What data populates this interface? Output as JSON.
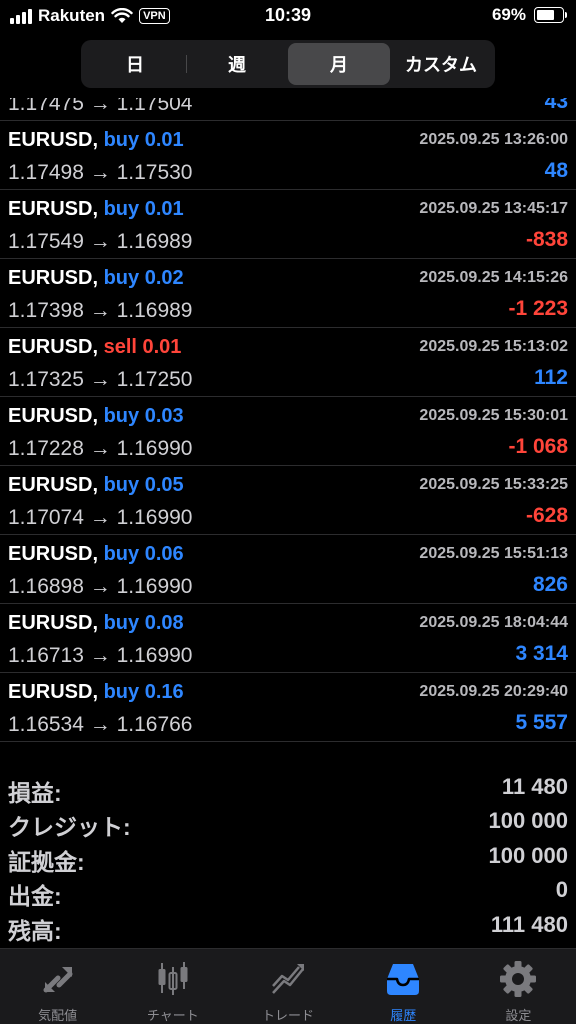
{
  "status_bar": {
    "carrier": "Rakuten",
    "vpn": "VPN",
    "time": "10:39",
    "battery": "69%",
    "battery_level": 0.69
  },
  "segments": [
    {
      "label": "日",
      "active": false
    },
    {
      "label": "週",
      "active": false
    },
    {
      "label": "月",
      "active": true
    },
    {
      "label": "カスタム",
      "active": false
    }
  ],
  "partial_row": {
    "prices": "1.17475 → 1.17504",
    "pl": "43"
  },
  "trades": [
    {
      "symbol": "EURUSD,",
      "type": "buy 0.01",
      "side": "buy",
      "datetime": "2025.09.25 13:26:00",
      "prices": "1.17498 → 1.17530",
      "pl": "48",
      "sign": "pos"
    },
    {
      "symbol": "EURUSD,",
      "type": "buy 0.01",
      "side": "buy",
      "datetime": "2025.09.25 13:45:17",
      "prices": "1.17549 → 1.16989",
      "pl": "-838",
      "sign": "neg"
    },
    {
      "symbol": "EURUSD,",
      "type": "buy 0.02",
      "side": "buy",
      "datetime": "2025.09.25 14:15:26",
      "prices": "1.17398 → 1.16989",
      "pl": "-1 223",
      "sign": "neg"
    },
    {
      "symbol": "EURUSD,",
      "type": "sell 0.01",
      "side": "sell",
      "datetime": "2025.09.25 15:13:02",
      "prices": "1.17325 → 1.17250",
      "pl": "112",
      "sign": "pos"
    },
    {
      "symbol": "EURUSD,",
      "type": "buy 0.03",
      "side": "buy",
      "datetime": "2025.09.25 15:30:01",
      "prices": "1.17228 → 1.16990",
      "pl": "-1 068",
      "sign": "neg"
    },
    {
      "symbol": "EURUSD,",
      "type": "buy 0.05",
      "side": "buy",
      "datetime": "2025.09.25 15:33:25",
      "prices": "1.17074 → 1.16990",
      "pl": "-628",
      "sign": "neg"
    },
    {
      "symbol": "EURUSD,",
      "type": "buy 0.06",
      "side": "buy",
      "datetime": "2025.09.25 15:51:13",
      "prices": "1.16898 → 1.16990",
      "pl": "826",
      "sign": "pos"
    },
    {
      "symbol": "EURUSD,",
      "type": "buy 0.08",
      "side": "buy",
      "datetime": "2025.09.25 18:04:44",
      "prices": "1.16713 → 1.16990",
      "pl": "3 314",
      "sign": "pos"
    },
    {
      "symbol": "EURUSD,",
      "type": "buy 0.16",
      "side": "buy",
      "datetime": "2025.09.25 20:29:40",
      "prices": "1.16534 → 1.16766",
      "pl": "5 557",
      "sign": "pos"
    }
  ],
  "summary": [
    {
      "label": "損益:",
      "value": "11 480"
    },
    {
      "label": "クレジット:",
      "value": "100 000"
    },
    {
      "label": "証拠金:",
      "value": "100 000"
    },
    {
      "label": "出金:",
      "value": "0"
    },
    {
      "label": "残高:",
      "value": "111 480"
    }
  ],
  "tabs": [
    {
      "label": "気配値",
      "icon": "quotes-icon",
      "active": false
    },
    {
      "label": "チャート",
      "icon": "chart-icon",
      "active": false
    },
    {
      "label": "トレード",
      "icon": "trade-icon",
      "active": false
    },
    {
      "label": "履歴",
      "icon": "history-icon",
      "active": true
    },
    {
      "label": "設定",
      "icon": "settings-icon",
      "active": false
    }
  ],
  "colors": {
    "buy": "#2e86ff",
    "sell": "#ff453a",
    "active_tab": "#2e86ff",
    "inactive_tab": "#8e8e93"
  }
}
